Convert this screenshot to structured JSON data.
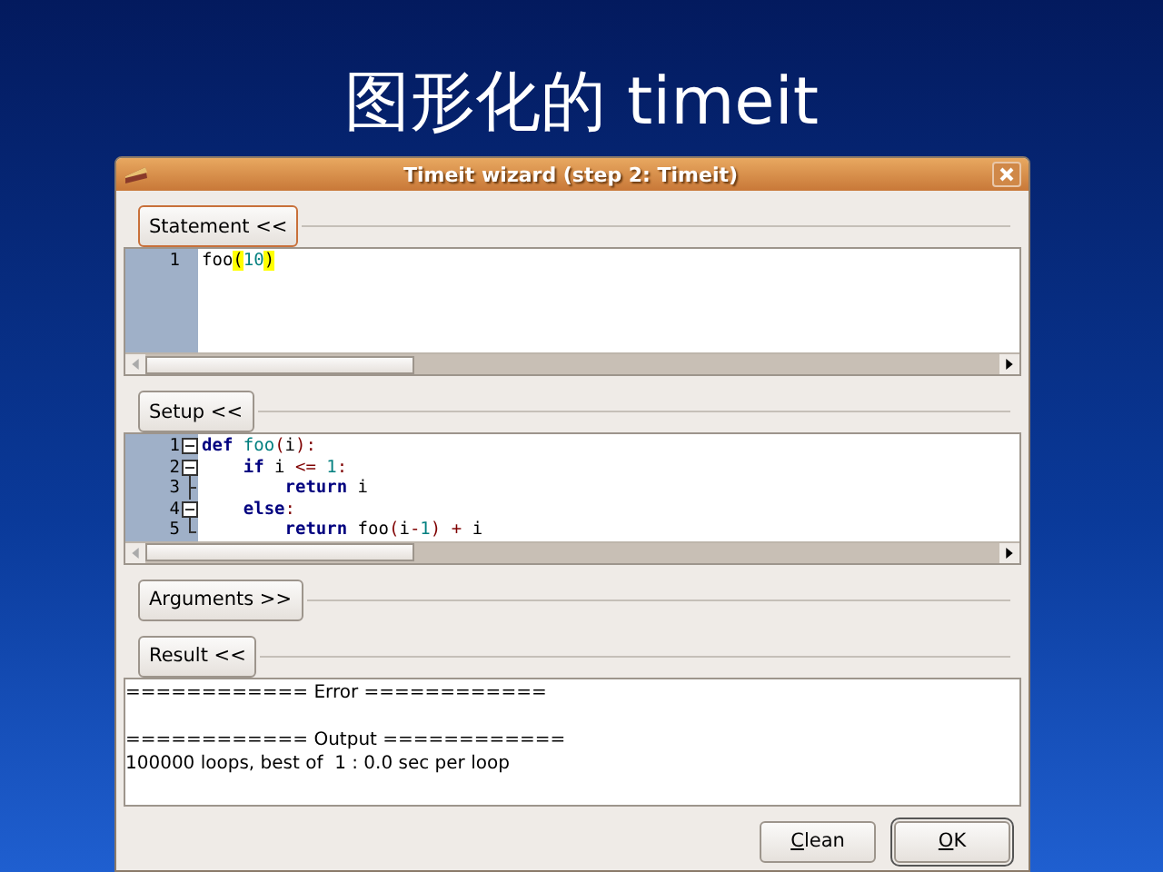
{
  "slide_title": "图形化的 timeit",
  "window": {
    "title": "Timeit wizard (step 2: Timeit)"
  },
  "sections": [
    {
      "kind": "editor",
      "toggle": "Statement <<",
      "focused": true,
      "lines": [
        {
          "number": "1",
          "tokens": [
            {
              "text": "foo",
              "kind": "plain"
            },
            {
              "text": "(",
              "kind": "brace"
            },
            {
              "text": "10",
              "kind": "number"
            },
            {
              "text": ")",
              "kind": "brace"
            }
          ]
        }
      ]
    },
    {
      "kind": "editor",
      "toggle": "Setup <<",
      "focused": false,
      "lines": [
        {
          "number": "1",
          "kind": "fold_open",
          "tokens": [
            {
              "text": "def",
              "kind": "keyword"
            },
            {
              "text": " foo",
              "kind": "name"
            },
            {
              "text": "(",
              "kind": "operator"
            },
            {
              "text": "i",
              "kind": "plain"
            },
            {
              "text": "):",
              "kind": "operator"
            }
          ]
        },
        {
          "number": "2",
          "kind": "fold_open",
          "tokens": [
            {
              "text": "    if",
              "kind": "keyword"
            },
            {
              "text": " i",
              "kind": "plain"
            },
            {
              "text": " <=",
              "kind": "operator"
            },
            {
              "text": " 1",
              "kind": "number"
            },
            {
              "text": ":",
              "kind": "operator"
            }
          ]
        },
        {
          "number": "3",
          "kind": "fold_branch",
          "tokens": [
            {
              "text": "        return",
              "kind": "keyword"
            },
            {
              "text": " i",
              "kind": "plain"
            }
          ]
        },
        {
          "number": "4",
          "kind": "fold_open",
          "tokens": [
            {
              "text": "    else",
              "kind": "keyword"
            },
            {
              "text": ":",
              "kind": "operator"
            }
          ]
        },
        {
          "number": "5",
          "kind": "fold_end",
          "tokens": [
            {
              "text": "        return",
              "kind": "keyword"
            },
            {
              "text": " foo",
              "kind": "plain"
            },
            {
              "text": "(",
              "kind": "operator"
            },
            {
              "text": "i",
              "kind": "plain"
            },
            {
              "text": "-",
              "kind": "operator"
            },
            {
              "text": "1",
              "kind": "number"
            },
            {
              "text": ")",
              "kind": "operator"
            },
            {
              "text": " +",
              "kind": "operator"
            },
            {
              "text": " i",
              "kind": "plain"
            }
          ]
        }
      ]
    },
    {
      "kind": "collapsed",
      "toggle": "Arguments >>",
      "focused": false
    },
    {
      "kind": "output",
      "toggle": "Result <<",
      "focused": false,
      "error_header": "============ Error ============",
      "output_header": "============ Output ============",
      "output_lines": [
        "100000 loops, best of  1 : 0.0 sec per loop"
      ]
    }
  ],
  "buttons": [
    {
      "label": "Clean"
    },
    {
      "label": "OK"
    }
  ]
}
